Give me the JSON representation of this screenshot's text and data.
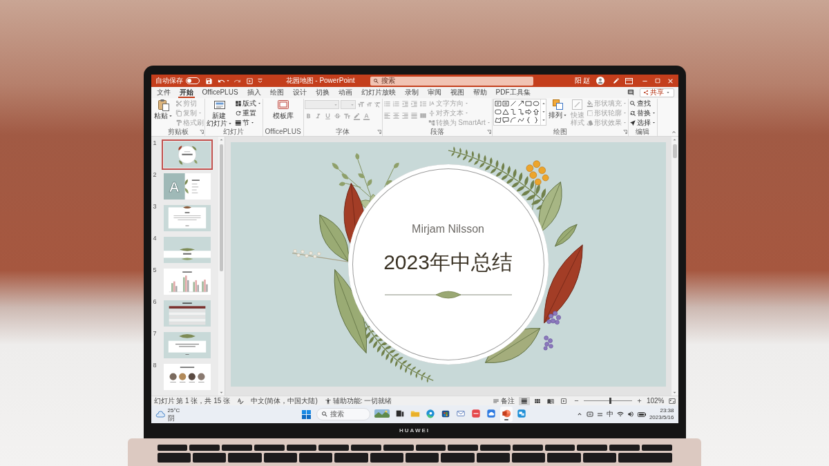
{
  "title_bar": {
    "autosave_label": "自动保存",
    "autosave_on": false,
    "document_title": "花园地图 - PowerPoint",
    "search": {
      "placeholder": "搜索"
    },
    "user_name": "阳 赵"
  },
  "ribbon_tabs": [
    {
      "label": "文件",
      "selected": false
    },
    {
      "label": "开始",
      "selected": true
    },
    {
      "label": "OfficePLUS",
      "selected": false
    },
    {
      "label": "插入",
      "selected": false
    },
    {
      "label": "绘图",
      "selected": false
    },
    {
      "label": "设计",
      "selected": false
    },
    {
      "label": "切换",
      "selected": false
    },
    {
      "label": "动画",
      "selected": false
    },
    {
      "label": "幻灯片放映",
      "selected": false
    },
    {
      "label": "录制",
      "selected": false
    },
    {
      "label": "审阅",
      "selected": false
    },
    {
      "label": "视图",
      "selected": false
    },
    {
      "label": "帮助",
      "selected": false
    },
    {
      "label": "PDF工具集",
      "selected": false
    }
  ],
  "share_button": {
    "label": "共享"
  },
  "ribbon_groups": [
    {
      "kind": "clipboard",
      "label": "剪贴板",
      "large": [
        {
          "label": "粘贴",
          "disabled": false
        }
      ],
      "small": [
        {
          "label": "剪切",
          "disabled": true
        },
        {
          "label": "复制",
          "disabled": true
        },
        {
          "label": "格式刷",
          "disabled": true
        }
      ]
    },
    {
      "kind": "slides",
      "label": "幻灯片",
      "large": [
        {
          "label": "新建幻灯片",
          "disabled": false
        }
      ],
      "small": [
        {
          "label": "版式",
          "disabled": false
        },
        {
          "label": "重置",
          "disabled": false
        },
        {
          "label": "节",
          "disabled": false
        }
      ]
    },
    {
      "kind": "addin",
      "label": "OfficePLUS",
      "large": [
        {
          "label": "模板库",
          "disabled": false
        }
      ]
    },
    {
      "kind": "font",
      "label": "字体",
      "disabled": true
    },
    {
      "kind": "paragraph",
      "label": "段落",
      "disabled": true,
      "small": [
        {
          "label": "文字方向",
          "disabled": true
        },
        {
          "label": "对齐文本",
          "disabled": true
        },
        {
          "label": "转换为 SmartArt",
          "disabled": true
        }
      ]
    },
    {
      "kind": "drawing",
      "label": "绘图",
      "large": [
        {
          "label": "排列",
          "disabled": false
        },
        {
          "label": "快速样式",
          "disabled": true
        }
      ],
      "small": [
        {
          "label": "形状填充",
          "disabled": true
        },
        {
          "label": "形状轮廓",
          "disabled": true
        },
        {
          "label": "形状效果",
          "disabled": true
        }
      ]
    },
    {
      "kind": "editing",
      "label": "编辑",
      "small": [
        {
          "label": "查找",
          "disabled": false
        },
        {
          "label": "替换",
          "disabled": false
        },
        {
          "label": "选择",
          "disabled": false
        }
      ]
    }
  ],
  "slides": [
    {
      "number": "1",
      "kind": "title",
      "selected": true
    },
    {
      "number": "2",
      "kind": "agenda",
      "selected": false,
      "initial": "A"
    },
    {
      "number": "3",
      "kind": "text",
      "selected": false
    },
    {
      "number": "4",
      "kind": "section",
      "selected": false
    },
    {
      "number": "5",
      "kind": "chart",
      "selected": false
    },
    {
      "number": "6",
      "kind": "table",
      "selected": false
    },
    {
      "number": "7",
      "kind": "quote",
      "selected": false
    },
    {
      "number": "8",
      "kind": "team",
      "selected": false
    }
  ],
  "slide": {
    "subtitle": "Mirjam Nilsson",
    "title": "2023年中总结"
  },
  "status_bar": {
    "slide_info": "幻灯片 第 1 张，共 15 张",
    "language": "中文(简体，中国大陆)",
    "accessibility": "辅助功能: 一切就绪",
    "notes": "备注",
    "views": [
      {
        "kind": "normal",
        "selected": true
      },
      {
        "kind": "sorter",
        "selected": false
      },
      {
        "kind": "reading",
        "selected": false
      },
      {
        "kind": "slideshow",
        "selected": false
      }
    ],
    "zoom": {
      "level": 0.55,
      "reading": "102%"
    }
  },
  "taskbar": {
    "weather": {
      "temperature": "25°C",
      "condition": "阴"
    },
    "search": {
      "placeholder": "搜索"
    },
    "apps": [
      {
        "kind": "widgets",
        "active": false
      },
      {
        "kind": "task_view",
        "active": false
      },
      {
        "kind": "explorer",
        "active": false
      },
      {
        "kind": "edge",
        "active": false
      },
      {
        "kind": "store",
        "active": false
      },
      {
        "kind": "mail",
        "active": false
      },
      {
        "kind": "red_app",
        "active": false
      },
      {
        "kind": "cloud_app",
        "active": false
      },
      {
        "kind": "powerpoint",
        "active": true
      },
      {
        "kind": "remote",
        "active": false
      }
    ],
    "ime": "中",
    "time": "23:38",
    "date": "2023/5/16"
  },
  "device": {
    "brand": "HUAWEI"
  }
}
